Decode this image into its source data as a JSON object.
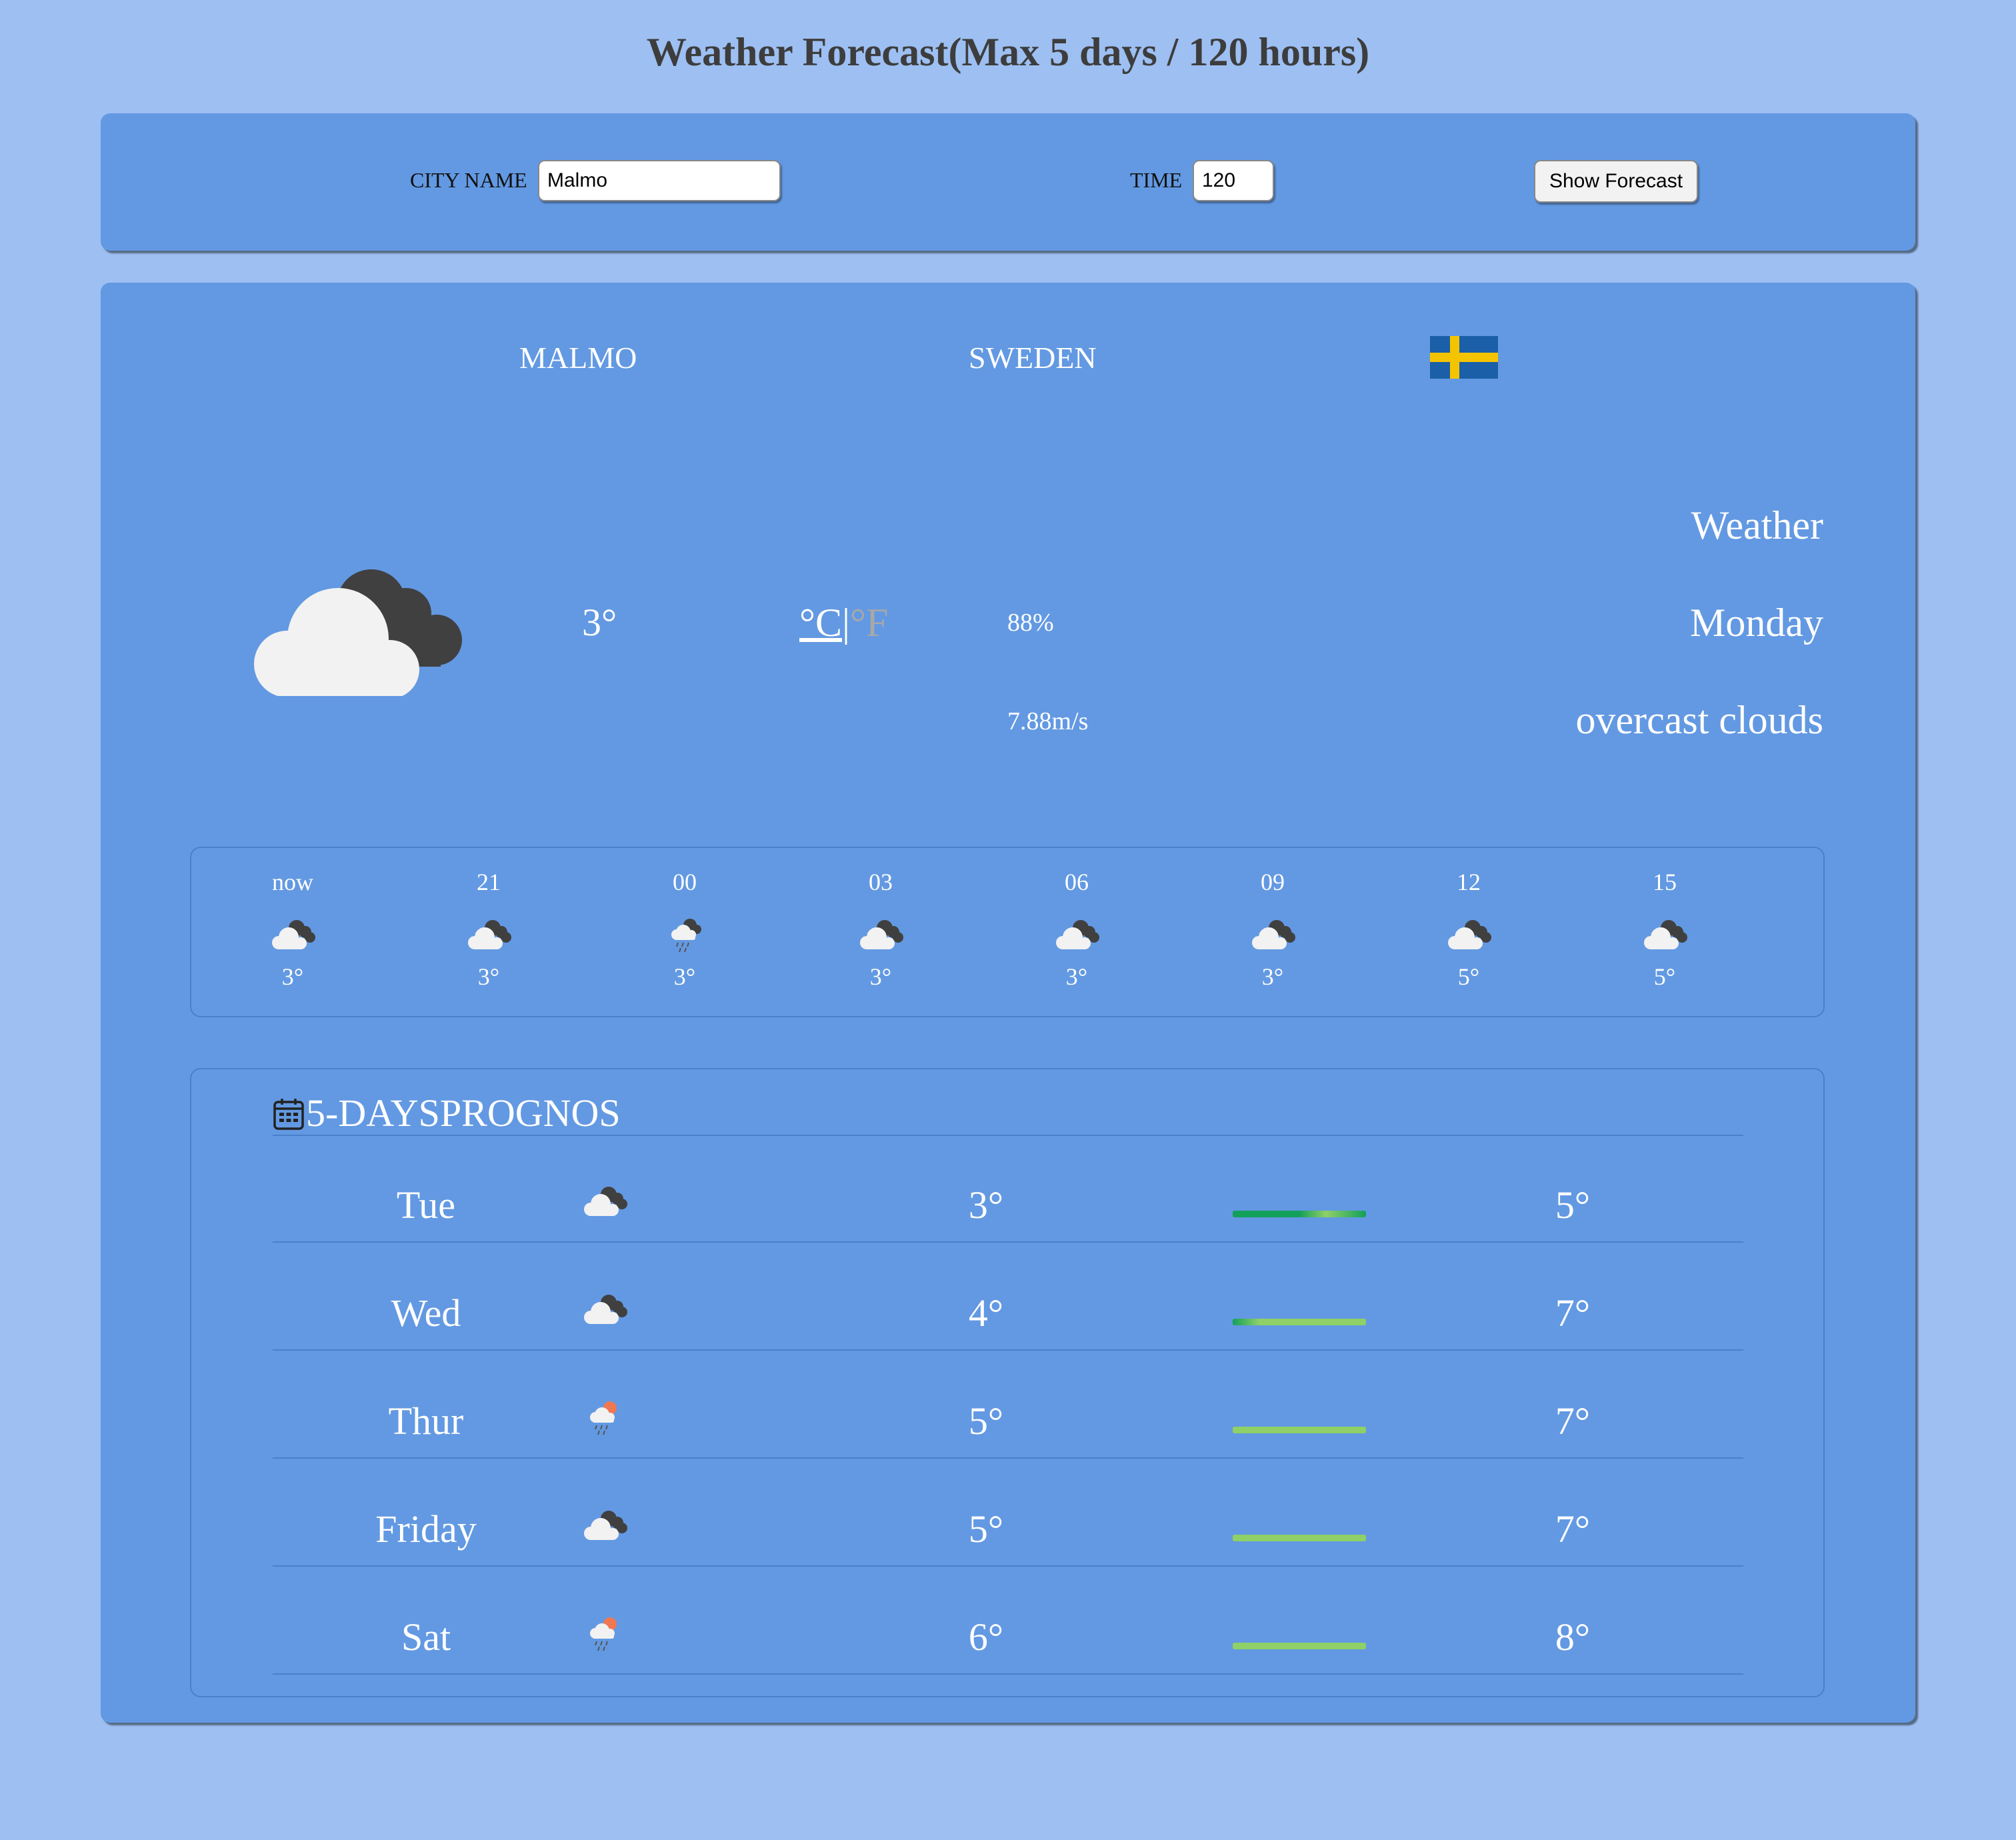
{
  "page": {
    "title": "Weather Forecast(Max 5 days / 120 hours)"
  },
  "search": {
    "city_label": "CITY NAME",
    "city_value": "Malmo",
    "time_label": "TIME",
    "time_value": "120",
    "button_label": "Show Forecast"
  },
  "location": {
    "city": "MALMO",
    "country": "SWEDEN",
    "flag_icon": "sweden-flag-icon"
  },
  "current": {
    "icon": "overcast-clouds-icon",
    "temperature": "3°",
    "unit_c": "°C",
    "unit_sep": "|",
    "unit_f": "°F",
    "humidity": "88%",
    "wind": "7.88m/s",
    "label": "Weather",
    "day": "Monday",
    "description": "overcast clouds"
  },
  "hourly": [
    {
      "hour": "now",
      "icon": "overcast-clouds-icon",
      "temp": "3°"
    },
    {
      "hour": "21",
      "icon": "overcast-clouds-icon",
      "temp": "3°"
    },
    {
      "hour": "00",
      "icon": "rain-clouds-icon",
      "temp": "3°"
    },
    {
      "hour": "03",
      "icon": "overcast-clouds-icon",
      "temp": "3°"
    },
    {
      "hour": "06",
      "icon": "overcast-clouds-icon",
      "temp": "3°"
    },
    {
      "hour": "09",
      "icon": "overcast-clouds-icon",
      "temp": "3°"
    },
    {
      "hour": "12",
      "icon": "overcast-clouds-icon",
      "temp": "5°"
    },
    {
      "hour": "15",
      "icon": "overcast-clouds-icon",
      "temp": "5°"
    }
  ],
  "daily": {
    "title": "5-DAYSPROGNOS",
    "title_icon": "calendar-icon",
    "days": [
      {
        "day": "Tue",
        "icon": "overcast-clouds-icon",
        "min": "3°",
        "max": "5°",
        "bar": "dark"
      },
      {
        "day": "Wed",
        "icon": "overcast-clouds-icon",
        "min": "4°",
        "max": "7°",
        "bar": "mixed"
      },
      {
        "day": "Thur",
        "icon": "sun-rain-icon",
        "min": "5°",
        "max": "7°",
        "bar": "light"
      },
      {
        "day": "Friday",
        "icon": "overcast-clouds-icon",
        "min": "5°",
        "max": "7°",
        "bar": "light"
      },
      {
        "day": "Sat",
        "icon": "sun-rain-icon",
        "min": "6°",
        "max": "8°",
        "bar": "light"
      }
    ]
  },
  "colors": {
    "background": "#9dbff2",
    "panel": "#6399e2",
    "bar_dark": "#13a05a",
    "bar_light": "#8fd068",
    "flag_blue": "#1a5fa8",
    "flag_yellow": "#f5c400"
  }
}
